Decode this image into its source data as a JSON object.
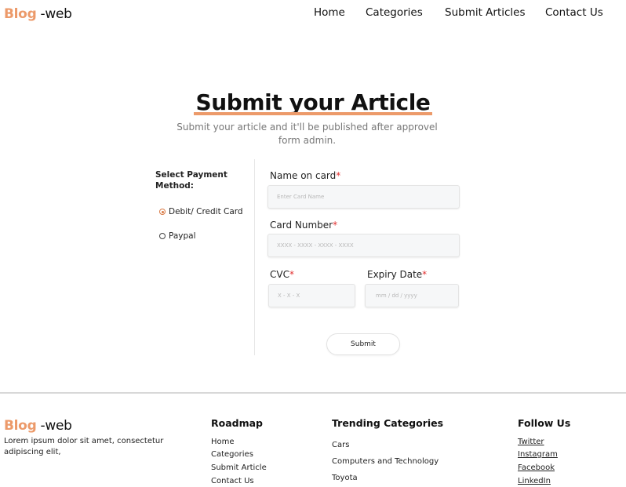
{
  "brand": {
    "part1": "Blog",
    "part2": " -web"
  },
  "nav": {
    "items": [
      "Home",
      "Categories",
      "Submit Articles",
      "Contact Us"
    ]
  },
  "hero": {
    "title": "Submit your Article",
    "subtitle": "Submit your article and it'll be published after approvel form admin."
  },
  "payment": {
    "title": "Select Payment Method:",
    "options": [
      {
        "label": "Debit/ Credit Card",
        "selected": true
      },
      {
        "label": "Paypal",
        "selected": false
      }
    ]
  },
  "form": {
    "name_label": "Name on card",
    "name_placeholder": "Enter Card Name",
    "number_label": "Card Number",
    "number_placeholder": "XXXX - XXXX - XXXX - XXXX",
    "cvc_label": "CVC",
    "cvc_placeholder": "X - X - X",
    "expiry_label": "Expiry Date",
    "expiry_placeholder": "mm / dd / yyyy",
    "required_mark": "*",
    "submit_label": "Submit"
  },
  "footer": {
    "brand": {
      "part1": "Blog",
      "part2": " -web"
    },
    "description": "Lorem ipsum dolor sit amet, consectetur adipiscing elit,",
    "roadmap": {
      "title": "Roadmap",
      "links": [
        "Home",
        "Categories",
        "Submit Article",
        "Contact Us"
      ]
    },
    "trending": {
      "title": "Trending Categories",
      "links": [
        "Cars",
        "Computers and Technology",
        "Toyota"
      ]
    },
    "follow": {
      "title": "Follow Us",
      "links": [
        "Twitter",
        "Instagram",
        "Facebook",
        "LinkedIn"
      ]
    }
  },
  "colors": {
    "accent": "#ec9a6a",
    "required": "#e23030",
    "radio_selected": "#d97a45"
  }
}
